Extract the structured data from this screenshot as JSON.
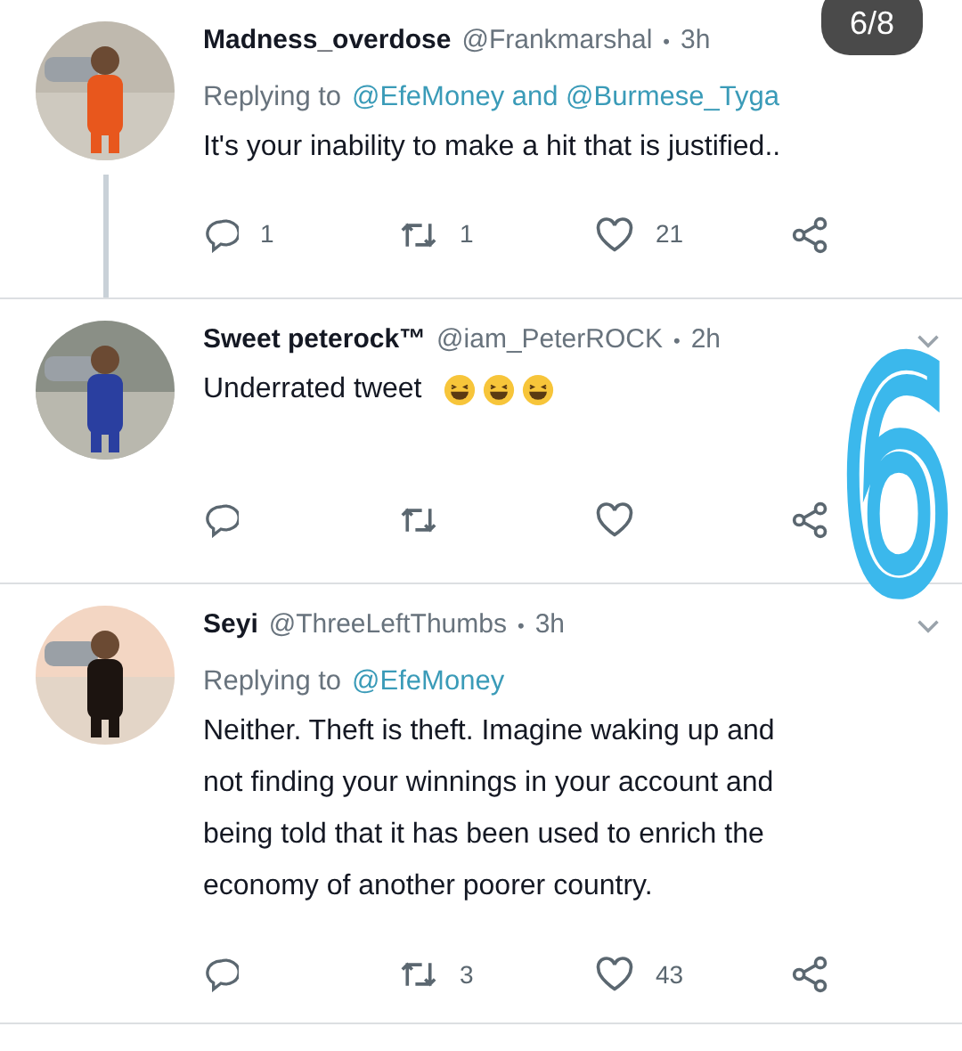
{
  "counter": "6/8",
  "overlay_mark": "6",
  "tweets": [
    {
      "name": "Madness_overdose",
      "handle": "@Frankmarshal",
      "dot": "•",
      "time": "3h",
      "thread_line": true,
      "caret": false,
      "replying": {
        "label": "Replying to",
        "mentions": "@EfeMoney and @Burmese_Tyga"
      },
      "text": "It's your inability to make a hit that is justified..",
      "stats": {
        "replies": "1",
        "retweets": "1",
        "likes": "21"
      }
    },
    {
      "name": "Sweet peterock™",
      "handle": "@iam_PeterROCK",
      "dot": "•",
      "time": "2h",
      "thread_line": false,
      "caret": true,
      "text": "Underrated tweet",
      "reactions": [
        {
          "kind": "laughing"
        },
        {
          "kind": "laughing"
        },
        {
          "kind": "laughing"
        }
      ]
    },
    {
      "name": "Seyi",
      "handle": "@ThreeLeftThumbs",
      "dot": "•",
      "time": "3h",
      "thread_line": false,
      "caret": true,
      "replying": {
        "label": "Replying to",
        "mentions": "@EfeMoney"
      },
      "text": "Neither. Theft is theft. Imagine waking up and not finding your winnings in your account and being told that it has been used to enrich the economy of another poorer country.",
      "stats": {
        "retweets": "3",
        "likes": "43"
      }
    }
  ]
}
